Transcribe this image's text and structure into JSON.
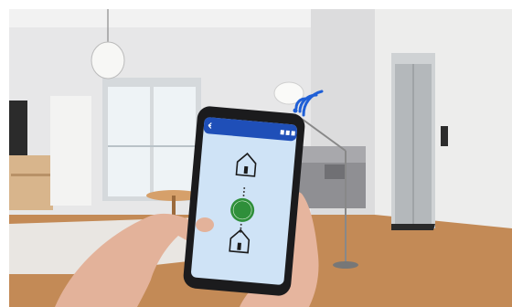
{
  "scene": {
    "wifi_badge_icon": "wifi-signal-icon",
    "colors": {
      "wall": "#e9e9ea",
      "floor": "#c68a57",
      "phone_screen": "#cfe3f6",
      "app_header": "#1f4fb8",
      "wifi_badge": "#1f5fd6",
      "center_button": "#2f8f3a"
    }
  },
  "phone": {
    "app_header": {
      "back_icon": "back-arrow-icon",
      "title": "",
      "status_icons": [
        "signal-icon",
        "wifi-icon",
        "battery-icon"
      ]
    },
    "upper_device": {
      "icon": "house-icon",
      "label": ""
    },
    "center_control": {
      "icon": "power-icon",
      "label": ""
    },
    "lower_device": {
      "icon": "house-icon",
      "label": ""
    }
  }
}
